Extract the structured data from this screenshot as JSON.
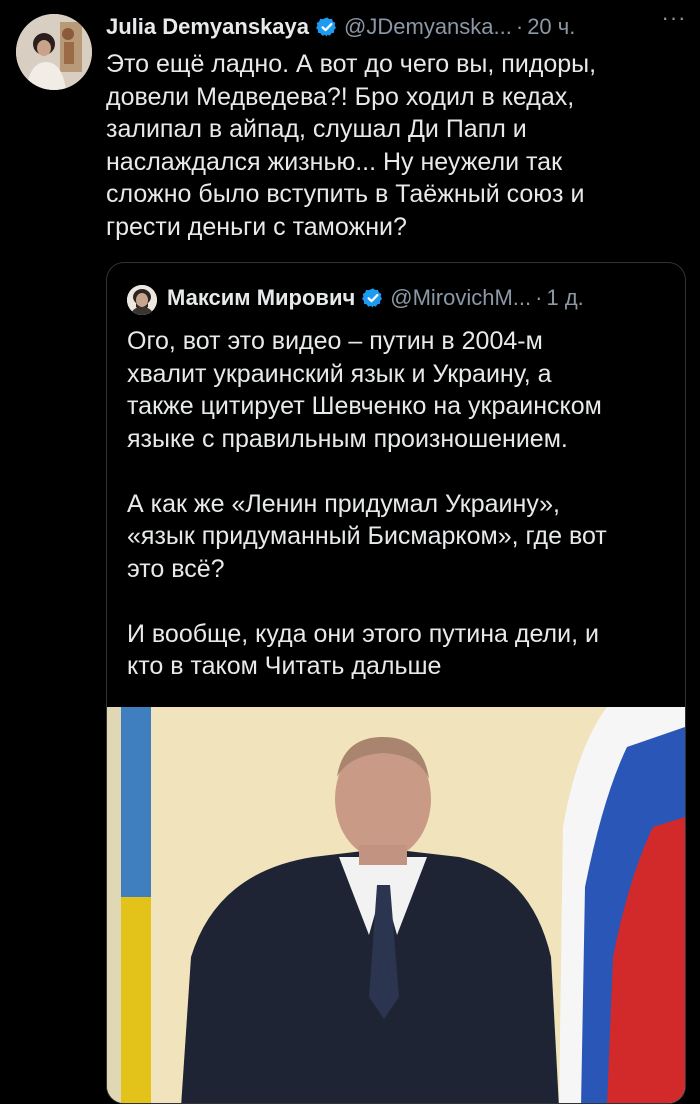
{
  "tweet": {
    "author_name": "Julia Demyanskaya",
    "handle": "@JDemyanska...",
    "separator": "·",
    "time": "20 ч.",
    "more_icon": "more-dots-icon",
    "text": "Это ещё ладно. А вот до чего вы, пидоры,\nдовели Медведева?! Бро ходил в кедах,\nзалипал в айпад, слушал Ди Папл и\nнаслаждался жизнью... Ну неужели так\nсложно было вступить в Таёжный союз и\nгрести деньги с таможни?"
  },
  "quoted_tweet": {
    "author_name": "Максим Мирович",
    "handle": "@MirovichM...",
    "separator": "·",
    "time": "1 д.",
    "text_main": "Ого, вот это видео – путин в 2004-м\nхвалит украинский язык и Украину, а\nтакже цитирует Шевченко на украинском\nязыке с правильным произношением.\n\nА как же «Ленин придумал Украину»,\n«язык придуманный Бисмарком», где вот\nэто всё?\n\nИ вообще, куда они этого путина дели, и\nкто в таком ",
    "read_more": "Читать дальше"
  },
  "colors": {
    "background": "#000000",
    "text": "#e7e9ea",
    "secondary_text": "#8b98a5",
    "border": "#2f3336",
    "verified_badge": "#1d9bf0"
  }
}
